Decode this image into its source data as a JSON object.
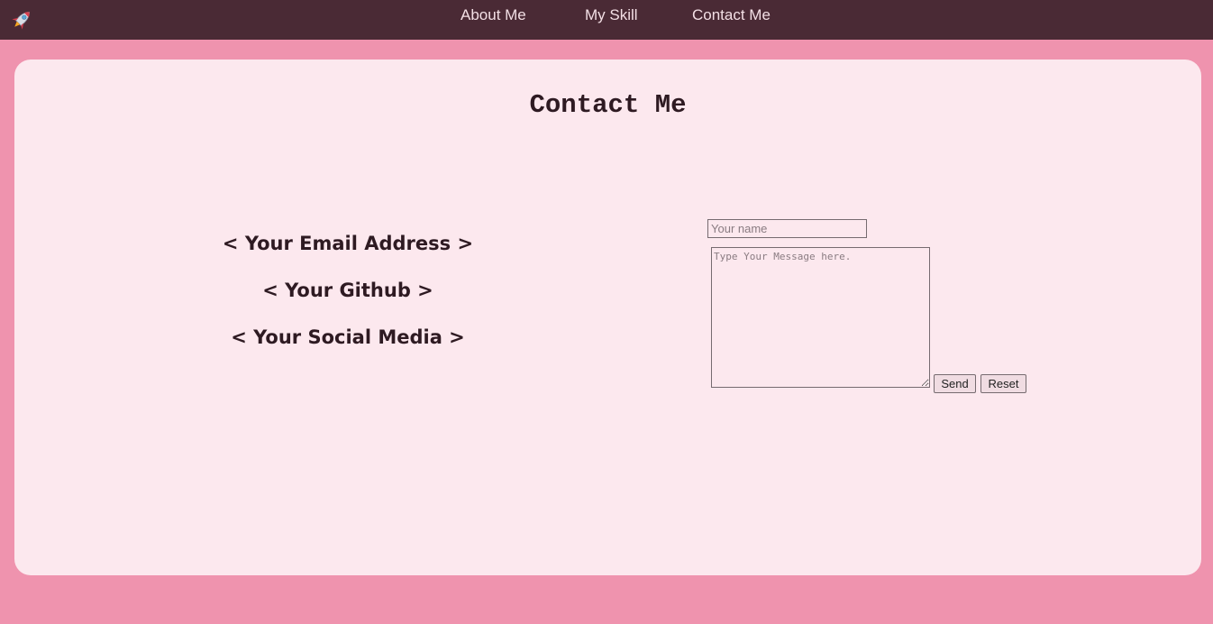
{
  "nav": {
    "logo_icon": "rocket-icon",
    "items": [
      {
        "label": "About Me"
      },
      {
        "label": "My Skill"
      },
      {
        "label": "Contact Me"
      }
    ]
  },
  "contact": {
    "title": "Contact Me",
    "email_text": "< Your Email Address >",
    "github_text": "< Your Github >",
    "social_text": "< Your Social Media >"
  },
  "form": {
    "name_placeholder": "Your name",
    "name_value": "",
    "message_placeholder": "Type Your Message here.",
    "message_value": "",
    "send_label": "Send",
    "reset_label": "Reset"
  },
  "colors": {
    "page_background": "#ef93ae",
    "navbar": "#4a2a35",
    "card": "#fce8ee",
    "text": "#2e1a22"
  }
}
